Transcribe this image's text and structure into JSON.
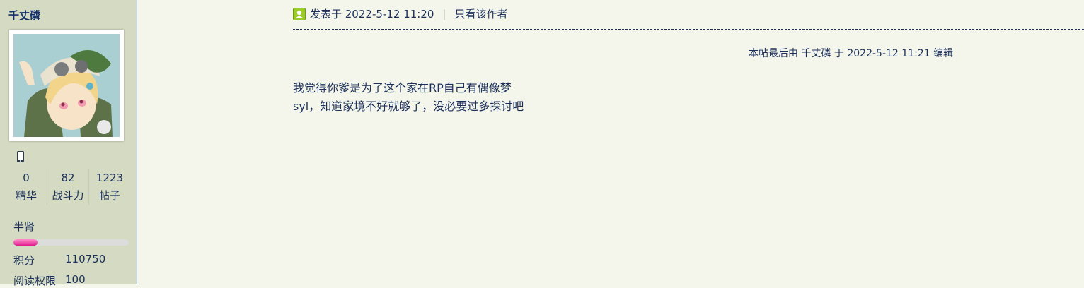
{
  "sidebar": {
    "username": "千丈磷",
    "stats": [
      {
        "value": "0",
        "label": "精华"
      },
      {
        "value": "82",
        "label": "战斗力"
      },
      {
        "value": "1223",
        "label": "帖子"
      }
    ],
    "rank": "半肾",
    "rank_progress_percent": 21,
    "rows": [
      {
        "label": "积分",
        "value": "110750"
      },
      {
        "label": "阅读权限",
        "value": "100"
      }
    ]
  },
  "post": {
    "posted_at": "发表于 2022-5-12 11:20",
    "only_author": "只看该作者",
    "edit_note": "本帖最后由 千丈磷 于 2022-5-12 11:21 编辑",
    "lines": [
      "我觉得你爹是为了这个家在RP自己有偶像梦",
      "syl，知道家境不好就够了，没必要过多探讨吧"
    ]
  },
  "icons": {
    "user": "user-icon",
    "mobile": "mobile-phone-icon"
  },
  "colors": {
    "text": "#1b2f5a",
    "sidebar_bg": "#d4dbc2",
    "page_bg": "#f4f6ec",
    "progress_fill": "#e0198a"
  }
}
